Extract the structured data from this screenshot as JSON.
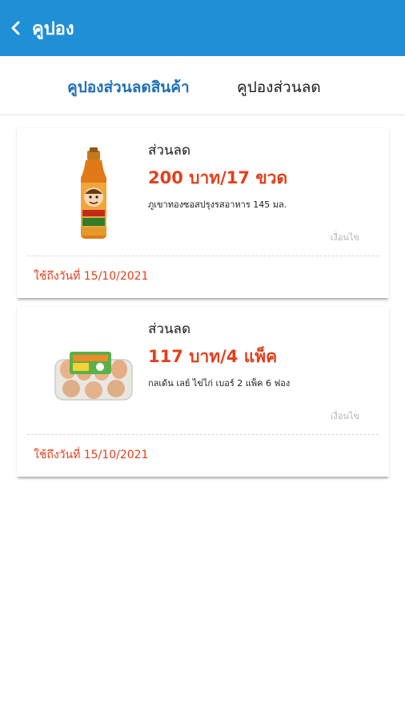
{
  "header": {
    "title": "คูปอง",
    "back_icon": "chevron-left-icon",
    "background": "#1f8fd6"
  },
  "tabs": [
    {
      "label": "คูปองส่วนลดสินค้า",
      "active": true
    },
    {
      "label": "คูปองส่วนลด",
      "active": false
    }
  ],
  "coupons": [
    {
      "kind": "ส่วนลด",
      "amount": "200 บาท/17 ขวด",
      "product": "ภูเขาทองซอสปรุงรสอาหาร 145 มล.",
      "condition": "เงื่อนไข",
      "expiry": "ใช้ถึงวันที่ 15/10/2021",
      "image": "sauce-bottle-image"
    },
    {
      "kind": "ส่วนลด",
      "amount": "117 บาท/4 แพ็ค",
      "product": "กลเด้น เลย์ ไข่ไก่ เบอร์ 2 แพ็ค 6 ฟอง",
      "condition": "เงื่อนไข",
      "expiry": "ใช้ถึงวันที่ 15/10/2021",
      "image": "egg-pack-image"
    }
  ],
  "colors": {
    "accent": "#1f8fd6",
    "active_tab": "#1f6fb8",
    "price": "#e2401c"
  }
}
